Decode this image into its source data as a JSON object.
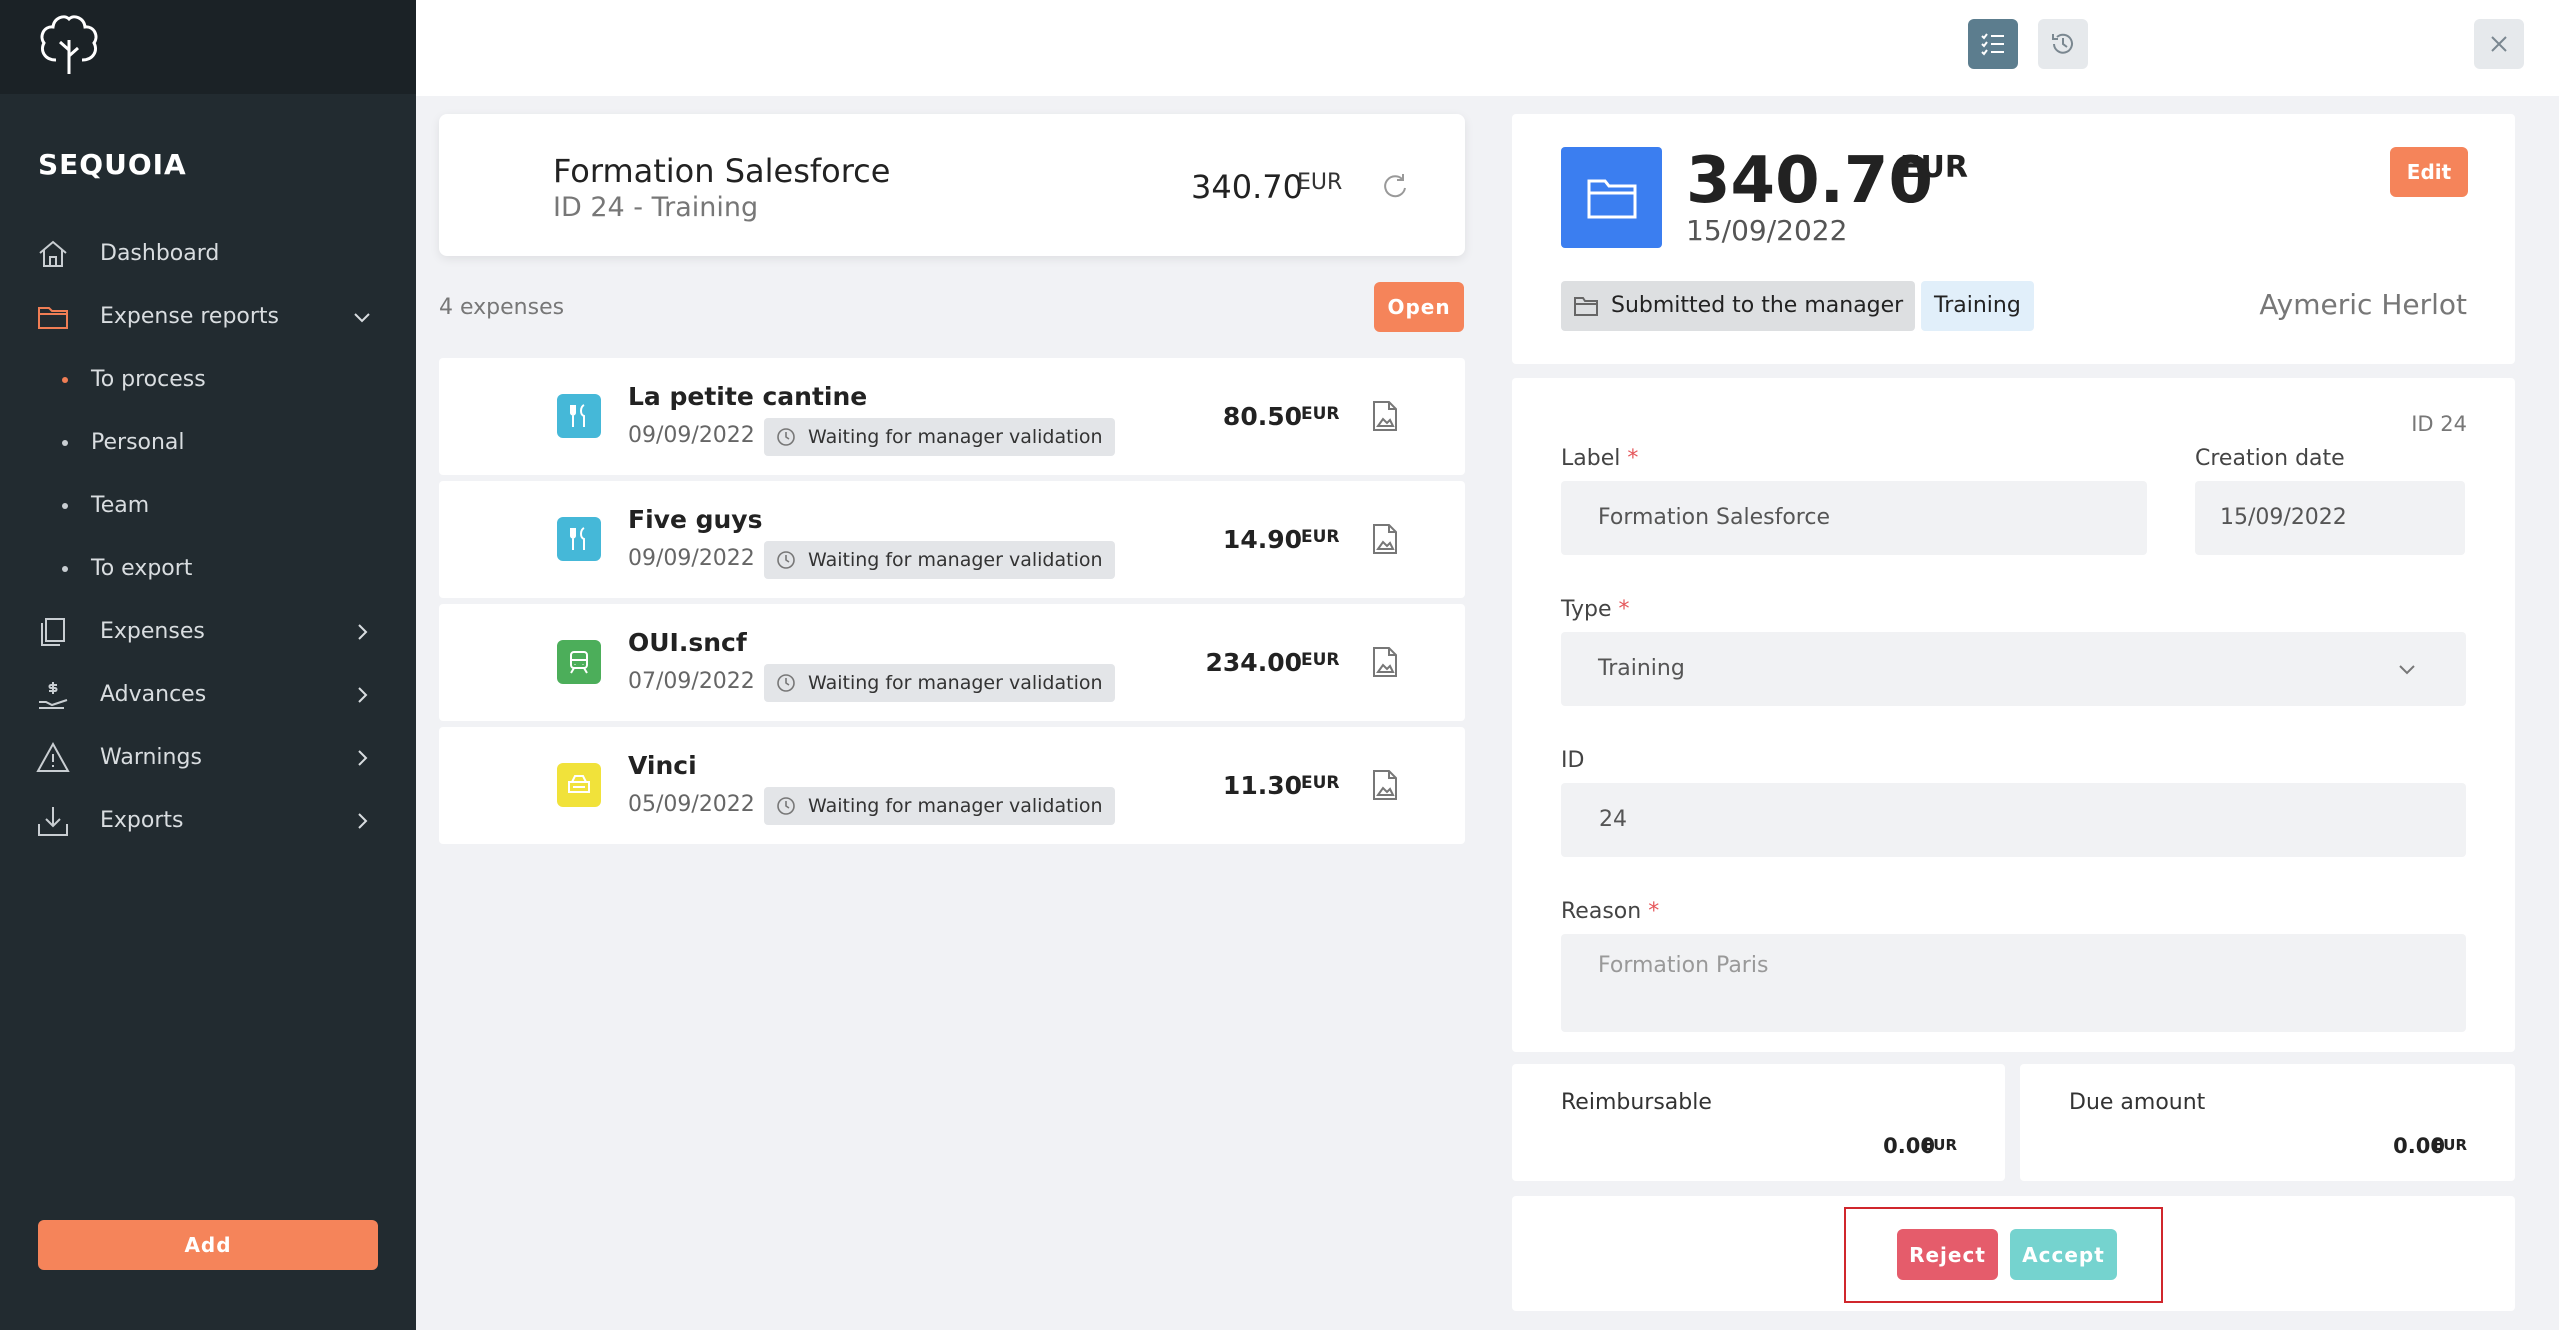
{
  "app": {
    "brand": "SEQUOIA",
    "add_label": "Add"
  },
  "sidebar": {
    "items": [
      {
        "label": "Dashboard",
        "icon": "home-icon"
      },
      {
        "label": "Expense reports",
        "icon": "folder-icon",
        "expanded": true
      },
      {
        "label": "Expenses",
        "icon": "receipt-icon"
      },
      {
        "label": "Advances",
        "icon": "hand-money-icon"
      },
      {
        "label": "Warnings",
        "icon": "warning-icon"
      },
      {
        "label": "Exports",
        "icon": "download-icon"
      }
    ],
    "sub_items": [
      {
        "label": "To process",
        "active": true
      },
      {
        "label": "Personal"
      },
      {
        "label": "Team"
      },
      {
        "label": "To export"
      }
    ]
  },
  "report": {
    "title": "Formation Salesforce",
    "subtitle": "ID 24 - Training",
    "amount": "340.70",
    "currency": "EUR",
    "expense_count": "4 expenses",
    "open_label": "Open"
  },
  "expenses": [
    {
      "name": "La petite cantine",
      "date": "09/09/2022",
      "status": "Waiting for manager validation",
      "amount": "80.50",
      "currency": "EUR",
      "icon": "restaurant-icon",
      "color": "#45b8d8"
    },
    {
      "name": "Five guys",
      "date": "09/09/2022",
      "status": "Waiting for manager validation",
      "amount": "14.90",
      "currency": "EUR",
      "icon": "restaurant-icon",
      "color": "#45b8d8"
    },
    {
      "name": "OUI.sncf",
      "date": "07/09/2022",
      "status": "Waiting for manager validation",
      "amount": "234.00",
      "currency": "EUR",
      "icon": "train-icon",
      "color": "#4cae5a"
    },
    {
      "name": "Vinci",
      "date": "05/09/2022",
      "status": "Waiting for manager validation",
      "amount": "11.30",
      "currency": "EUR",
      "icon": "toll-icon",
      "color": "#f1e23a"
    }
  ],
  "detail": {
    "amount": "340.70",
    "currency": "EUR",
    "date": "15/09/2022",
    "edit_label": "Edit",
    "status_badge": "Submitted to the manager",
    "type_badge": "Training",
    "user": "Aymeric Herlot",
    "id_text": "ID 24"
  },
  "form": {
    "label_title": "Label",
    "label_value": "Formation Salesforce",
    "creation_title": "Creation date",
    "creation_value": "15/09/2022",
    "type_title": "Type",
    "type_value": "Training",
    "id_title": "ID",
    "id_value": "24",
    "reason_title": "Reason",
    "reason_placeholder": "Formation Paris",
    "required_mark": "*"
  },
  "summary": {
    "reimbursable_title": "Reimbursable",
    "reimbursable_amount": "0.00",
    "due_title": "Due amount",
    "due_amount": "0.00",
    "currency": "EUR"
  },
  "actions": {
    "reject_label": "Reject",
    "accept_label": "Accept"
  },
  "colors": {
    "accent": "#f5845a",
    "reject": "#e55c6b",
    "accept": "#75d3cf",
    "primary_blue": "#3b7ef0"
  }
}
